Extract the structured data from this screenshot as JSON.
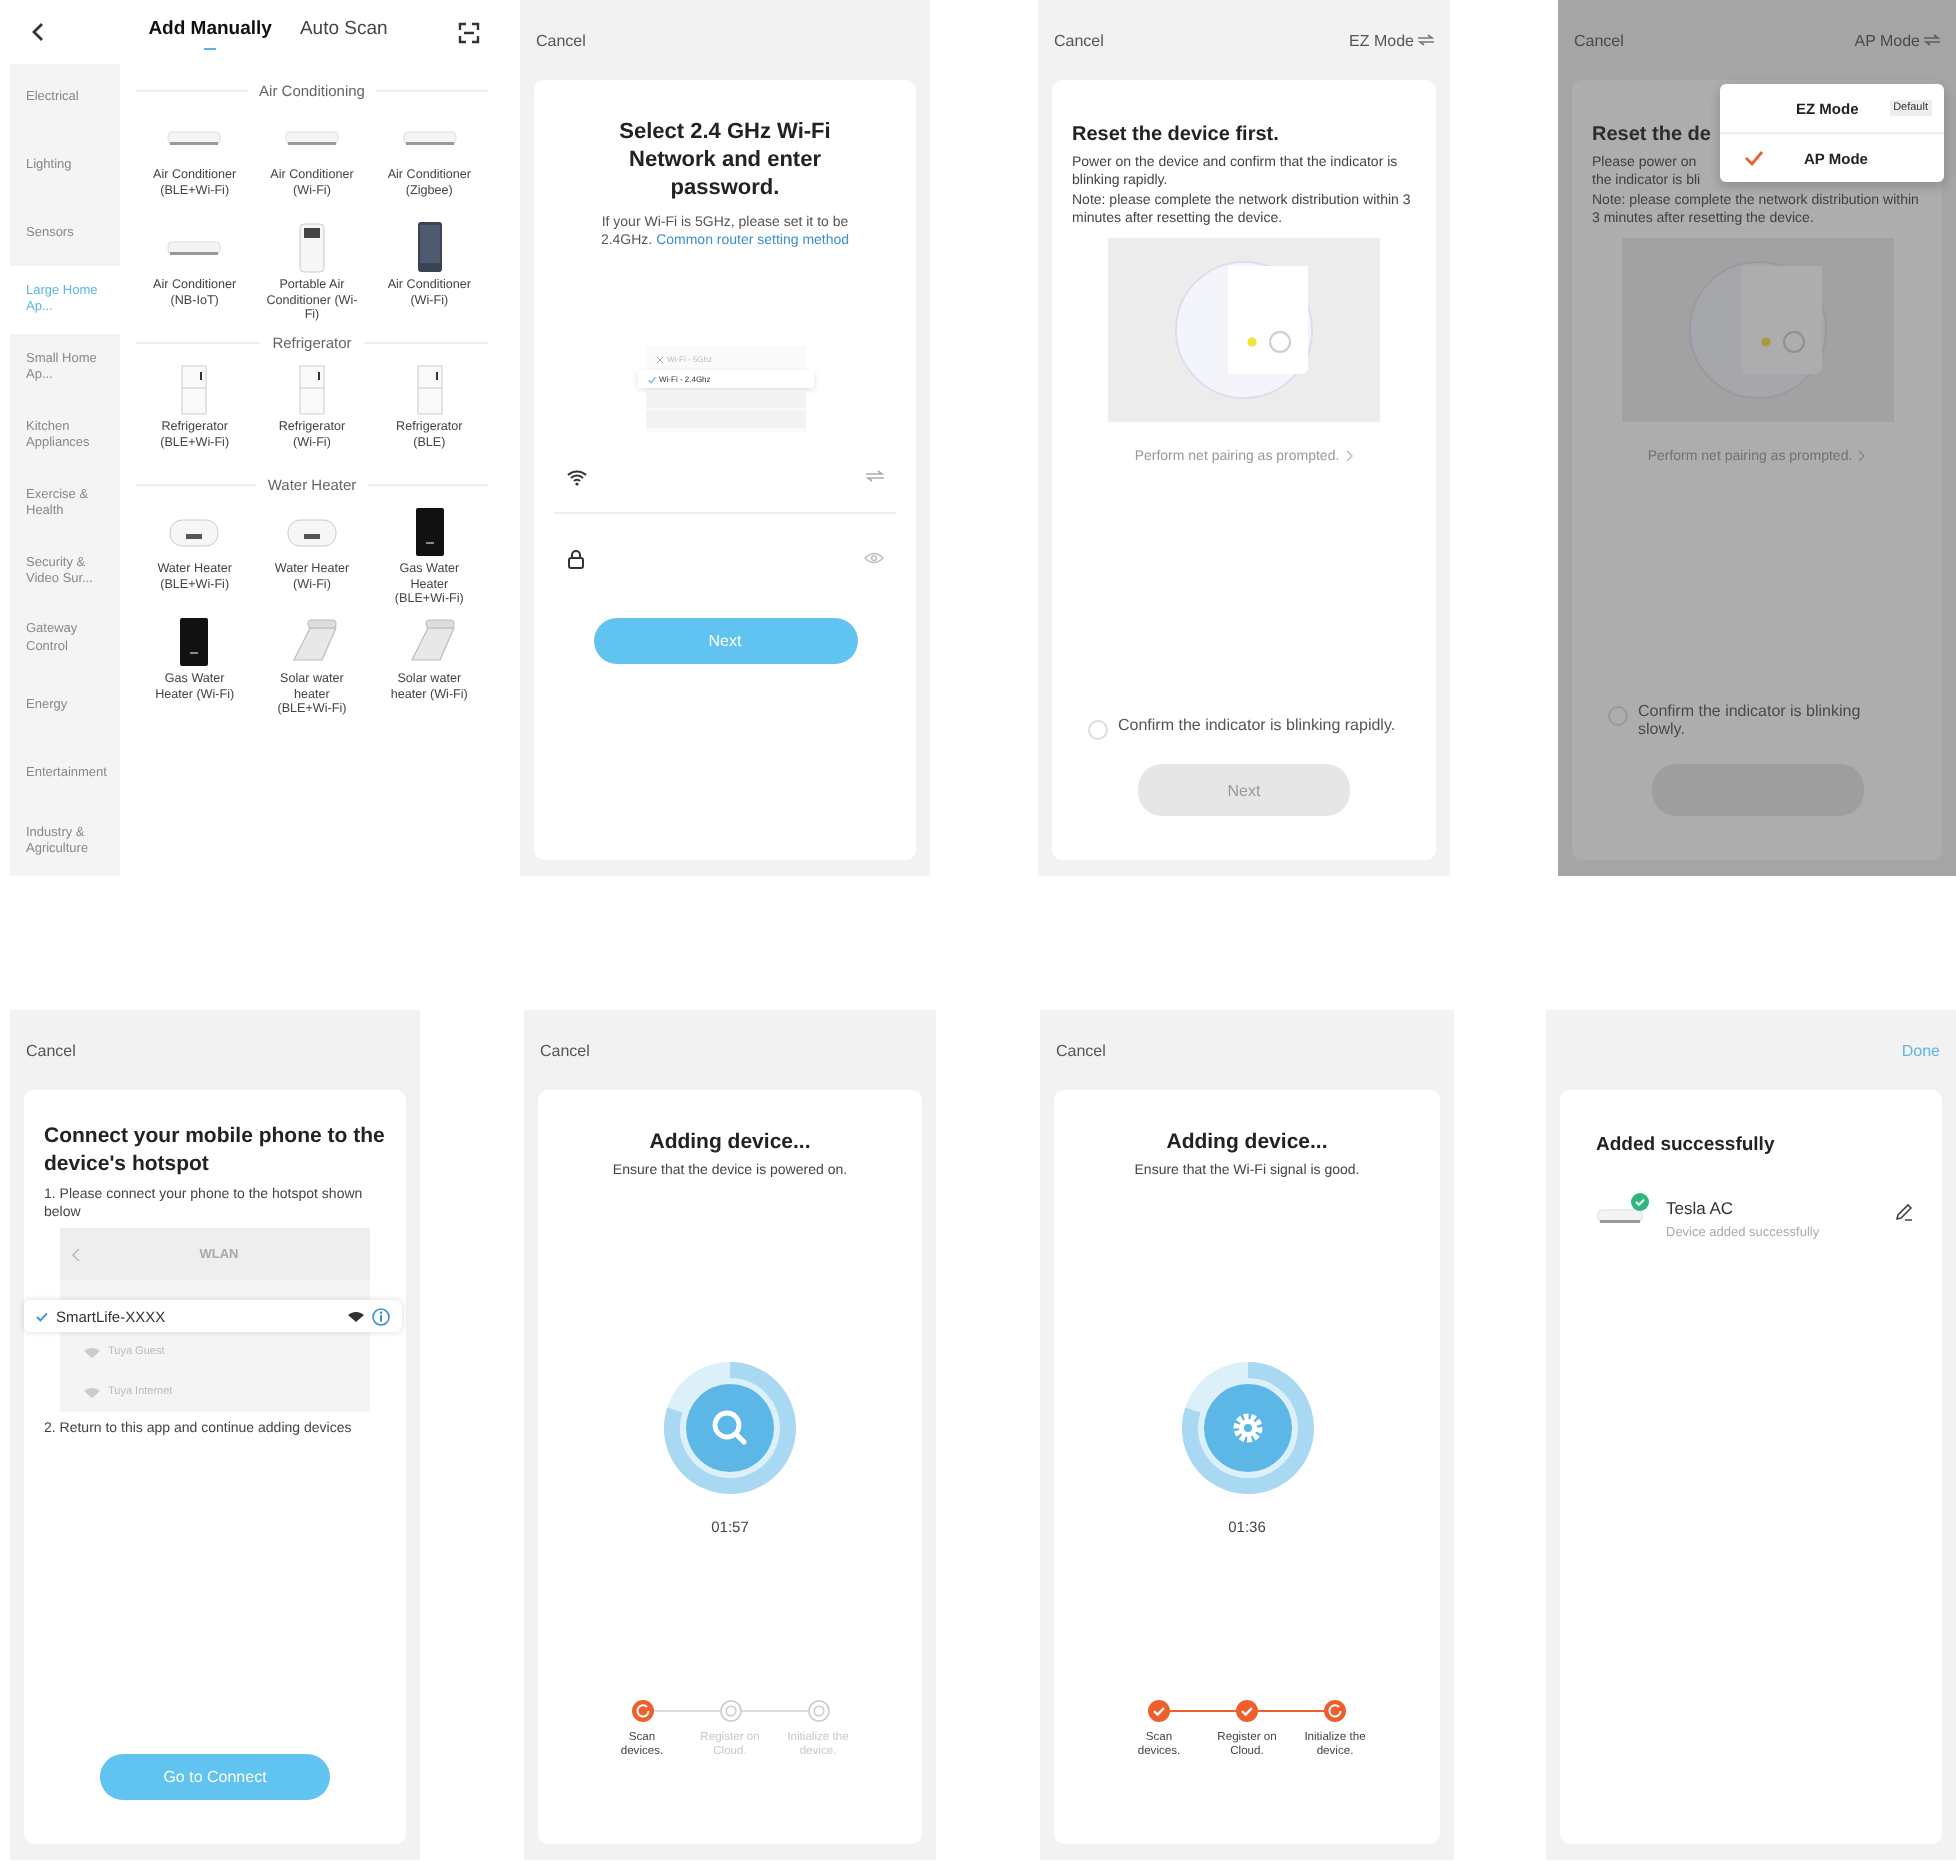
{
  "screens": [
    {
      "kind": "catalog",
      "tabs": [
        {
          "label": "Add Manually",
          "selected": true
        },
        {
          "label": "Auto Scan",
          "selected": false
        }
      ],
      "categories": [
        {
          "label": "Electrical",
          "selected": false
        },
        {
          "label": "Lighting",
          "selected": false
        },
        {
          "label": "Sensors",
          "selected": false
        },
        {
          "label": "Large Home Ap...",
          "selected": true
        },
        {
          "label": "Small Home Ap...",
          "selected": false
        },
        {
          "label": "Kitchen Appliances",
          "selected": false
        },
        {
          "label": "Exercise & Health",
          "selected": false
        },
        {
          "label": "Security & Video Sur...",
          "selected": false
        },
        {
          "label": "Gateway Control",
          "selected": false
        },
        {
          "label": "Energy",
          "selected": false
        },
        {
          "label": "Entertainment",
          "selected": false
        },
        {
          "label": "Industry & Agriculture",
          "selected": false
        }
      ],
      "sections": [
        {
          "title": "Air Conditioning",
          "devices": [
            {
              "name": "Air Conditioner (BLE+Wi-Fi)",
              "kind": "ceiling"
            },
            {
              "name": "Air Conditioner (Wi-Fi)",
              "kind": "ceiling"
            },
            {
              "name": "Air Conditioner (Zigbee)",
              "kind": "ceiling"
            },
            {
              "name": "Air Conditioner (NB-IoT)",
              "kind": "ceiling"
            },
            {
              "name": "Portable Air Conditioner (Wi-Fi)",
              "kind": "portable"
            },
            {
              "name": "Air Conditioner (Wi-Fi)",
              "kind": "panel"
            }
          ]
        },
        {
          "title": "Refrigerator",
          "devices": [
            {
              "name": "Refrigerator (BLE+Wi-Fi)",
              "kind": "fridge"
            },
            {
              "name": "Refrigerator (Wi-Fi)",
              "kind": "fridge"
            },
            {
              "name": "Refrigerator (BLE)",
              "kind": "fridge"
            }
          ]
        },
        {
          "title": "Water Heater",
          "devices": [
            {
              "name": "Water Heater (BLE+Wi-Fi)",
              "kind": "tank"
            },
            {
              "name": "Water Heater (Wi-Fi)",
              "kind": "tank"
            },
            {
              "name": "Gas Water Heater (BLE+Wi-Fi)",
              "kind": "gas"
            },
            {
              "name": "Gas Water Heater (Wi-Fi)",
              "kind": "gas"
            },
            {
              "name": "Solar water heater (BLE+Wi-Fi)",
              "kind": "solar"
            },
            {
              "name": "Solar water heater (Wi-Fi)",
              "kind": "solar"
            }
          ]
        }
      ]
    },
    {
      "kind": "wifi",
      "cancel": "Cancel",
      "title": "Select 2.4 GHz Wi-Fi Network and enter password.",
      "hint": "If your Wi-Fi is 5GHz, please set it to be 2.4GHz.",
      "link": "Common router setting method",
      "networks": [
        {
          "label": "Wi-Fi - 5Ghz",
          "selected": false
        },
        {
          "label": "Wi-Fi - 2.4Ghz",
          "selected": true
        }
      ],
      "button": "Next"
    },
    {
      "kind": "reset",
      "cancel": "Cancel",
      "mode": "EZ Mode",
      "title": "Reset the device first.",
      "lines": [
        "Power on the device and confirm that the indicator is blinking rapidly.",
        "Note: please complete the network distribution within 3 minutes after resetting the device."
      ],
      "link": "Perform net pairing as prompted.",
      "confirm": {
        "label": "Confirm the indicator is blinking rapidly.",
        "checked": false
      },
      "button": {
        "label": "Next",
        "disabled": true
      }
    },
    {
      "kind": "reset",
      "cancel": "Cancel",
      "mode": "AP Mode",
      "title": "Reset the de",
      "lines": [
        "Please power on",
        "the indicator is bli",
        "Note: please complete the network distribution within 3 minutes after resetting the device."
      ],
      "link": "Perform net pairing as prompted.",
      "confirm": {
        "label": "Confirm the indicator is blinking slowly.",
        "checked": false
      },
      "button": {
        "disabled": true
      },
      "menu": [
        {
          "label": "EZ Mode",
          "badge": "Default",
          "selected": false
        },
        {
          "label": "AP Mode",
          "selected": true
        }
      ]
    },
    {
      "kind": "hotspot",
      "cancel": "Cancel",
      "title": "Connect your mobile phone to the device's hotspot",
      "step1": "1. Please connect your phone to the hotspot shown below",
      "wlan": "WLAN",
      "networks": [
        {
          "name": "SmartLife-XXXX",
          "selected": true
        },
        {
          "name": "Tuya Guest",
          "selected": false
        },
        {
          "name": "Tuya Internet",
          "selected": false
        }
      ],
      "step2": "2. Return to this app and continue adding devices",
      "button": "Go to Connect"
    },
    {
      "kind": "adding",
      "cancel": "Cancel",
      "title": "Adding device...",
      "subtitle": "Ensure that the device is powered on.",
      "timer": "01:57",
      "steps": [
        {
          "label": "Scan devices.",
          "done": false,
          "active": true
        },
        {
          "label": "Register on Cloud.",
          "done": false,
          "active": false
        },
        {
          "label": "Initialize the device.",
          "done": false,
          "active": false
        }
      ]
    },
    {
      "kind": "adding",
      "cancel": "Cancel",
      "title": "Adding device...",
      "subtitle": "Ensure that the Wi-Fi signal is good.",
      "timer": "01:36",
      "steps": [
        {
          "label": "Scan devices.",
          "done": true,
          "active": false
        },
        {
          "label": "Register on Cloud.",
          "done": true,
          "active": false
        },
        {
          "label": "Initialize the device.",
          "done": false,
          "active": true
        }
      ]
    },
    {
      "kind": "success",
      "done": "Done",
      "title": "Added successfully",
      "device": {
        "name": "Tesla AC",
        "status": "Device added successfully"
      }
    }
  ]
}
